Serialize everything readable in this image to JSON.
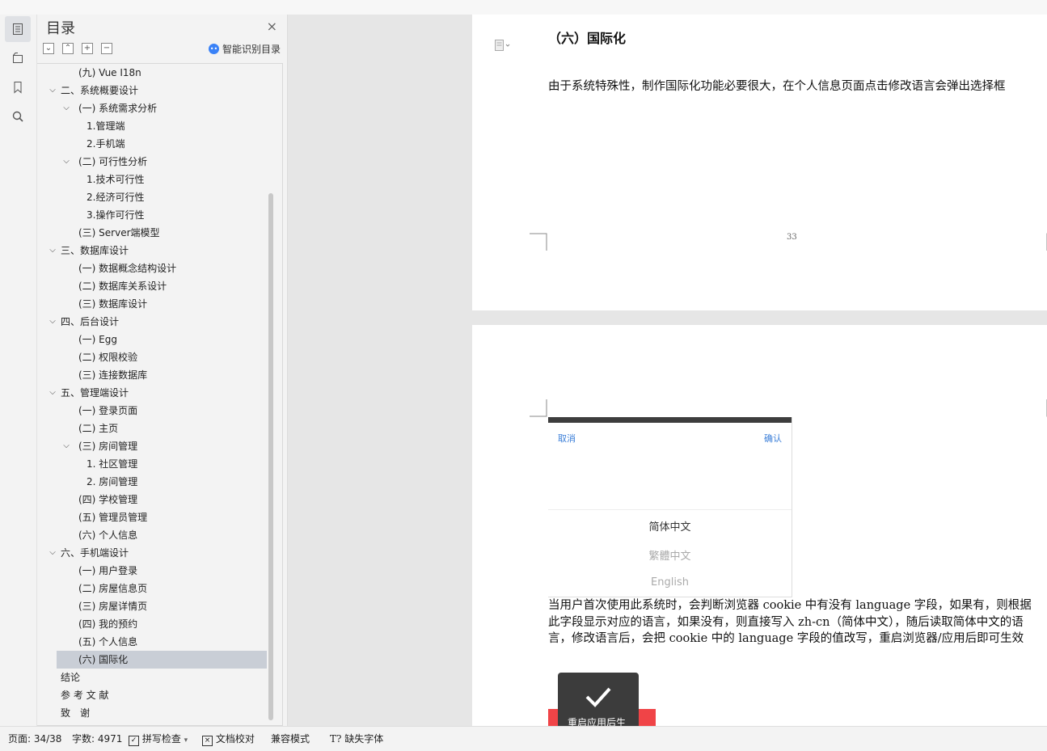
{
  "sidebar": {
    "title": "目录",
    "smart_toc_label": "智能识别目录",
    "tool_buttons": [
      "⌄",
      "⌃",
      "+",
      "−"
    ],
    "items": [
      {
        "label": "(九) Vue I18n",
        "level": 2,
        "expanded": null
      },
      {
        "label": "二、系统概要设计",
        "level": 1,
        "expanded": true
      },
      {
        "label": "(一) 系统需求分析",
        "level": 2,
        "expanded": true
      },
      {
        "label": "1.管理端",
        "level": 3,
        "expanded": null
      },
      {
        "label": "2.手机端",
        "level": 3,
        "expanded": null
      },
      {
        "label": "(二) 可行性分析",
        "level": 2,
        "expanded": true
      },
      {
        "label": "1.技术可行性",
        "level": 3,
        "expanded": null
      },
      {
        "label": "2.经济可行性",
        "level": 3,
        "expanded": null
      },
      {
        "label": "3.操作可行性",
        "level": 3,
        "expanded": null
      },
      {
        "label": "(三) Server端模型",
        "level": 2,
        "expanded": null
      },
      {
        "label": "三、数据库设计",
        "level": 1,
        "expanded": true
      },
      {
        "label": "(一) 数据概念结构设计",
        "level": 2,
        "expanded": null
      },
      {
        "label": "(二) 数据库关系设计",
        "level": 2,
        "expanded": null
      },
      {
        "label": "(三) 数据库设计",
        "level": 2,
        "expanded": null
      },
      {
        "label": "四、后台设计",
        "level": 1,
        "expanded": true
      },
      {
        "label": "(一)  Egg",
        "level": 2,
        "expanded": null
      },
      {
        "label": "(二)  权限校验",
        "level": 2,
        "expanded": null
      },
      {
        "label": "(三) 连接数据库",
        "level": 2,
        "expanded": null
      },
      {
        "label": "五、管理端设计",
        "level": 1,
        "expanded": true
      },
      {
        "label": "(一) 登录页面",
        "level": 2,
        "expanded": null
      },
      {
        "label": "(二) 主页",
        "level": 2,
        "expanded": null
      },
      {
        "label": "(三) 房间管理",
        "level": 2,
        "expanded": true
      },
      {
        "label": "1. 社区管理",
        "level": 3,
        "expanded": null
      },
      {
        "label": "2. 房间管理",
        "level": 3,
        "expanded": null
      },
      {
        "label": "(四) 学校管理",
        "level": 2,
        "expanded": null
      },
      {
        "label": "(五) 管理员管理",
        "level": 2,
        "expanded": null
      },
      {
        "label": "(六) 个人信息",
        "level": 2,
        "expanded": null
      },
      {
        "label": "六、手机端设计",
        "level": 1,
        "expanded": true
      },
      {
        "label": "(一) 用户登录",
        "level": 2,
        "expanded": null
      },
      {
        "label": "(二) 房屋信息页",
        "level": 2,
        "expanded": null
      },
      {
        "label": "(三) 房屋详情页",
        "level": 2,
        "expanded": null
      },
      {
        "label": "(四) 我的预约",
        "level": 2,
        "expanded": null
      },
      {
        "label": "(五) 个人信息",
        "level": 2,
        "expanded": null
      },
      {
        "label": "(六) 国际化",
        "level": 2,
        "expanded": null,
        "selected": true
      },
      {
        "label": "结论",
        "level": 0,
        "expanded": null
      },
      {
        "label": "参 考 文 献",
        "level": 0,
        "expanded": null
      },
      {
        "label": "致　谢",
        "level": 0,
        "expanded": null
      }
    ]
  },
  "document": {
    "page1": {
      "heading": "（六）国际化",
      "paragraph": "由于系统特殊性，制作国际化功能必要很大，在个人信息页面点击修改语言会弹出选择框",
      "page_number": "33"
    },
    "page2": {
      "picker": {
        "cancel": "取消",
        "confirm": "确认",
        "options": [
          "简体中文",
          "繁體中文",
          "English"
        ]
      },
      "paragraph": "当用户首次使用此系统时，会判断浏览器 cookie 中有没有 language 字段，如果有，则根据此字段显示对应的语言，如果没有，则直接写入 zh-cn（简体中文），随后读取简体中文的语言，修改语言后，会把 cookie 中的 language 字段的值改写，重启浏览器/应用后即可生效",
      "toast_text": "重启应用后生效!"
    }
  },
  "statusbar": {
    "page": "页面: 34/38",
    "words": "字数: 4971",
    "spellcheck": "拼写检查",
    "proofread": "文档校对",
    "compat": "兼容模式",
    "missing_fonts": "缺失字体"
  },
  "colors": {
    "accent": "#3a82f7",
    "selected_row": "#c9ced6",
    "toast_red": "#f04447"
  }
}
